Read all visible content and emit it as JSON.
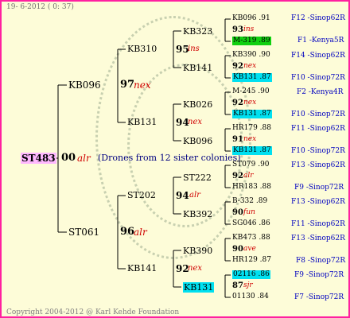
{
  "header": {
    "date_text": "19-  6-2012 (  0: 37)"
  },
  "root": {
    "name": "ST483",
    "year": "00",
    "marker": "alr",
    "note": "(Drones from 12 sister colonies)"
  },
  "gen1": [
    {
      "name": "KB096",
      "year": "97",
      "marker": "nex"
    },
    {
      "name": "ST061",
      "year": "96",
      "marker": "alr"
    }
  ],
  "gen2": [
    {
      "name": "KB310",
      "year": "95",
      "marker": "ins"
    },
    {
      "name": "KB131",
      "year": "94",
      "marker": "nex"
    },
    {
      "name": "ST202",
      "year": "94",
      "marker": "alr"
    },
    {
      "name": "KB141",
      "year": "92",
      "marker": "nex"
    }
  ],
  "gen3": [
    "KB323",
    "KB141",
    "KB026",
    "KB096",
    "ST222",
    "KB392",
    "KB390",
    "KB131"
  ],
  "gen4": [
    {
      "name": "KB096 .91",
      "year": "93",
      "marker": "ins",
      "mother": "M-319 .89"
    },
    {
      "name": "KB390 .90",
      "year": "92",
      "marker": "nex",
      "mother": "KB131 .87"
    },
    {
      "name": "M-245 .90",
      "year": "92",
      "marker": "nex",
      "mother": "KB131 .87"
    },
    {
      "name": "HR179 .88",
      "year": "91",
      "marker": "nex",
      "mother": "KB131 .87"
    },
    {
      "name": "ST079 .90",
      "year": "92",
      "marker": "alr",
      "mother": "HR183 .88"
    },
    {
      "name": "B-332 .89",
      "year": "90",
      "marker": "fun",
      "mother": "SG046 .86"
    },
    {
      "name": "KB473 .88",
      "year": "90",
      "marker": "ave",
      "mother": "HR129 .87"
    },
    {
      "name": "02116 .86",
      "year": "87",
      "marker": "sjr",
      "mother": "01130 .84"
    }
  ],
  "right_labels": [
    "F12 -Sinop62R",
    "F1 -Kenya5R",
    "F14 -Sinop62R",
    "F10 -Sinop72R",
    "F2 -Kenya4R",
    "F10 -Sinop72R",
    "F11 -Sinop62R",
    "F10 -Sinop72R",
    "F13 -Sinop62R",
    "F9 -Sinop72R",
    "F13 -Sinop62R",
    "F11 -Sinop62R",
    "F13 -Sinop62R",
    "F8 -Sinop72R",
    "F9 -Sinop72R",
    "F7 -Sinop72R"
  ],
  "footer": {
    "copyright": "Copyright 2004-2012 @ Karl Kehde Foundation"
  },
  "colors": {
    "border": "#ff20a0",
    "background": "#fdfcd8",
    "marker": "#d00000",
    "right_label": "#0000c0",
    "highlight_pink": "#ffb8ff",
    "highlight_cyan": "#00e0f0",
    "highlight_green": "#10d010"
  }
}
